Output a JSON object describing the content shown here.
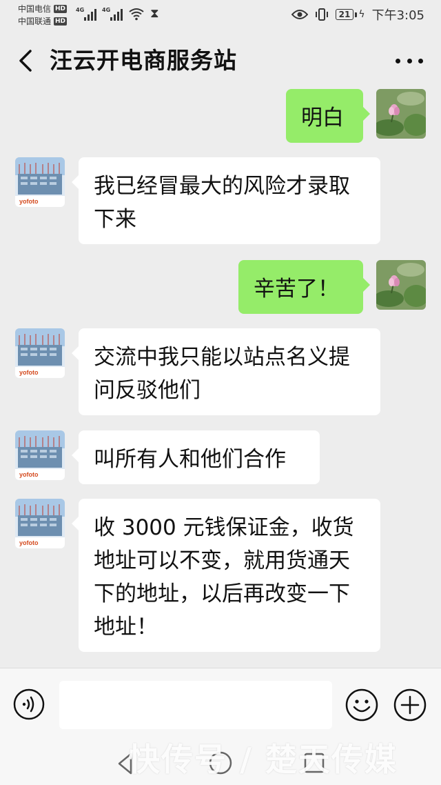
{
  "status_bar": {
    "carrier_1": "中国电信",
    "carrier_2": "中国联通",
    "hd_label": "HD",
    "network_1": "4G",
    "network_2": "4G",
    "battery": "21",
    "time": "下午3:05"
  },
  "header": {
    "title": "汪云开电商服务站",
    "back_icon": "chevron-left-icon",
    "more_icon": "more-dots-icon"
  },
  "messages": [
    {
      "side": "right",
      "text": "明白",
      "avatar": "lotus-avatar"
    },
    {
      "side": "left",
      "text": "我已经冒最大的风险才录取\n下来",
      "avatar": "yofoto-building-avatar"
    },
    {
      "side": "right",
      "text": "辛苦了！",
      "avatar": "lotus-avatar"
    },
    {
      "side": "left",
      "text": "交流中我只能以站点名义提\n问反驳他们",
      "avatar": "yofoto-building-avatar"
    },
    {
      "side": "left",
      "text": "叫所有人和他们合作",
      "avatar": "yofoto-building-avatar"
    },
    {
      "side": "left",
      "text": "收 3000 元钱保证金，收货\n地址可以不变，就用货通天\n下的地址，以后再改变一下\n地址！",
      "avatar": "yofoto-building-avatar"
    }
  ],
  "avatar_logo_text": "yofoto",
  "input_bar": {
    "placeholder": "",
    "voice_icon": "voice-icon",
    "emoji_icon": "emoji-icon",
    "plus_icon": "plus-icon"
  },
  "watermark": "快传号 / 楚天传媒",
  "colors": {
    "background": "#ededed",
    "outgoing_bubble": "#95ec69",
    "incoming_bubble": "#ffffff"
  }
}
